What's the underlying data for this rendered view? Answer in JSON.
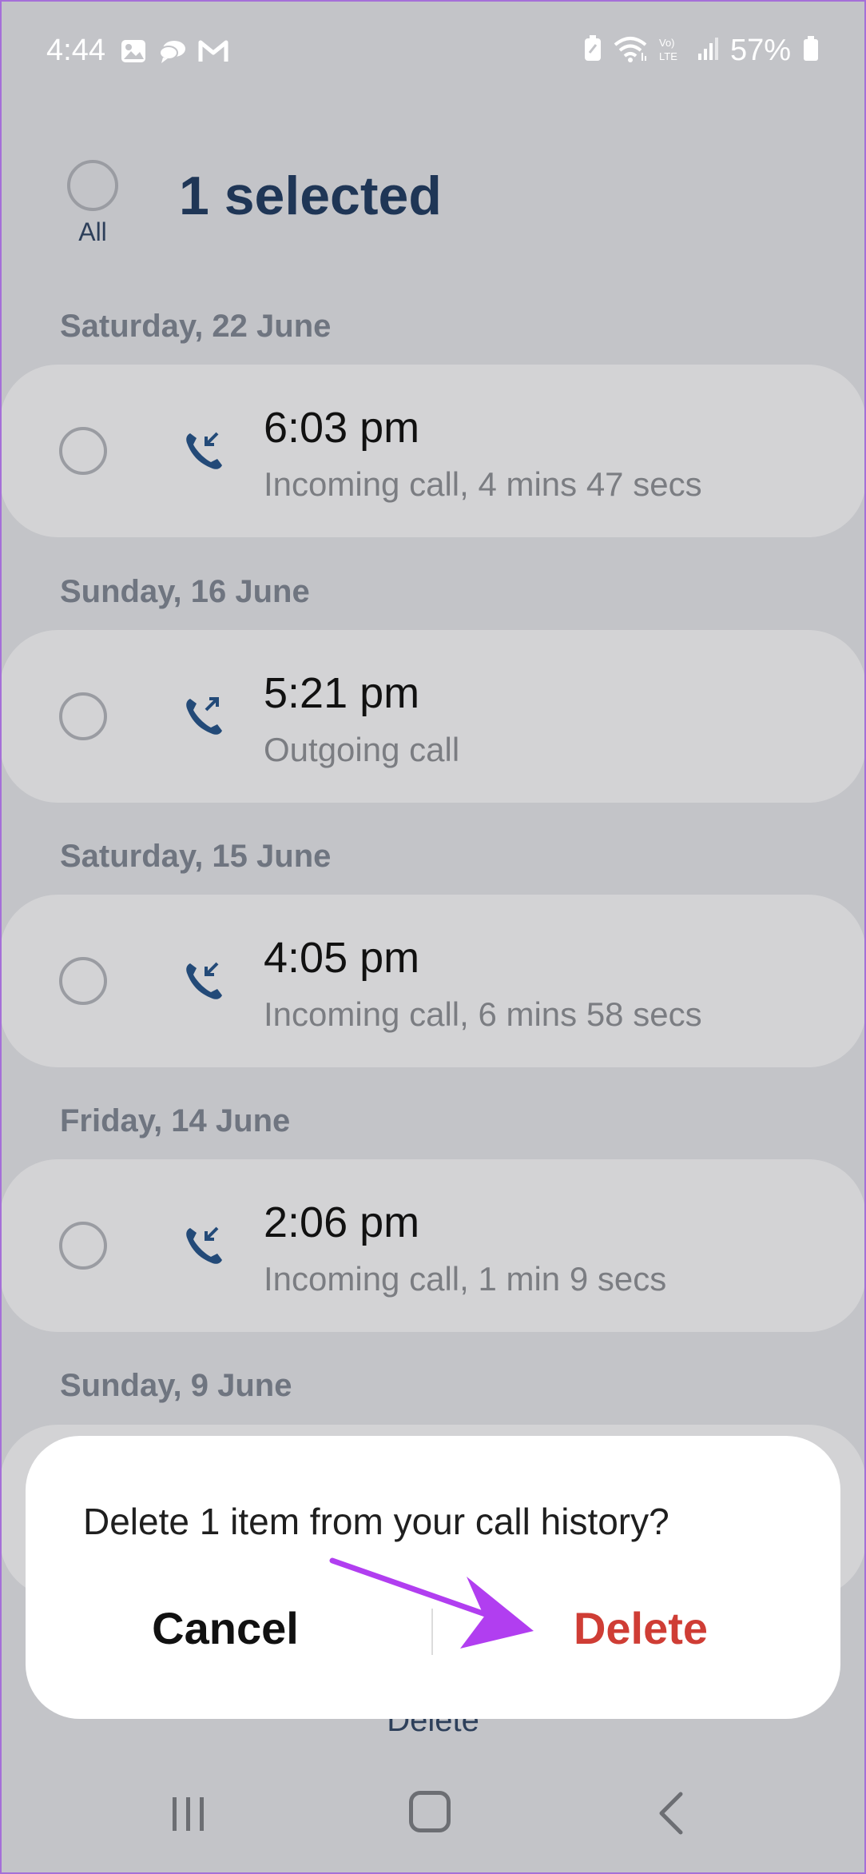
{
  "status_bar": {
    "time": "4:44",
    "battery": "57%",
    "icons": [
      "gallery-icon",
      "chat-icon",
      "gmail-icon",
      "battery-saver-icon",
      "wifi-icon",
      "volte-icon",
      "signal-icon",
      "battery-icon"
    ]
  },
  "header": {
    "select_all_label": "All",
    "title": "1 selected"
  },
  "sections": [
    {
      "date": "Saturday, 22 June",
      "time": "6:03 pm",
      "desc": "Incoming call, 4 mins 47 secs",
      "direction": "incoming"
    },
    {
      "date": "Sunday, 16 June",
      "time": "5:21 pm",
      "desc": "Outgoing call",
      "direction": "outgoing"
    },
    {
      "date": "Saturday, 15 June",
      "time": "4:05 pm",
      "desc": "Incoming call, 6 mins 58 secs",
      "direction": "incoming"
    },
    {
      "date": "Friday, 14 June",
      "time": "2:06 pm",
      "desc": "Incoming call, 1 min 9 secs",
      "direction": "incoming"
    },
    {
      "date": "Sunday, 9 June"
    }
  ],
  "dialog": {
    "message": "Delete 1 item from your call history?",
    "cancel_label": "Cancel",
    "delete_label": "Delete"
  },
  "bottom_bar": {
    "delete_label": "Delete"
  },
  "colors": {
    "accent_delete": "#cf3d35",
    "arrow": "#b13ef0",
    "title": "#1f3656"
  }
}
